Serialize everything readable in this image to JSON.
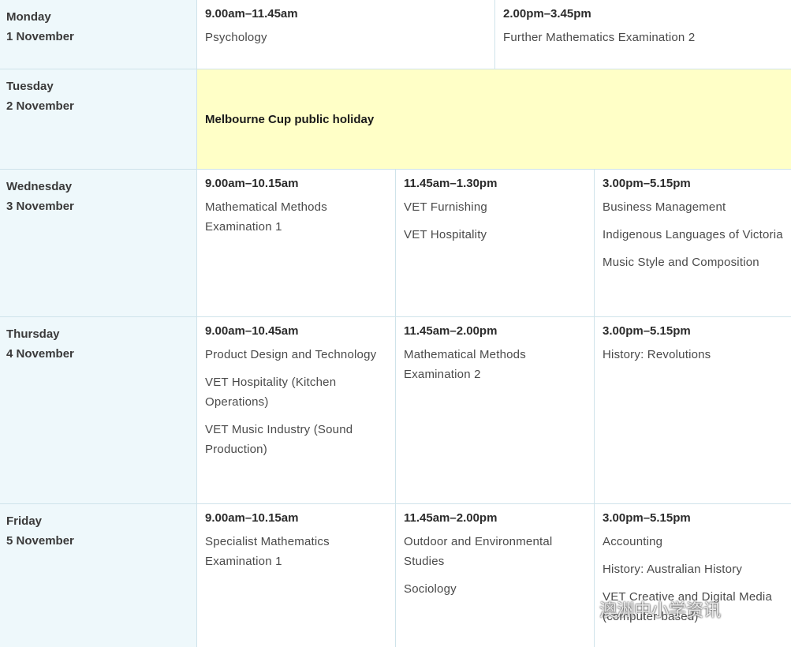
{
  "schedule": {
    "mon": {
      "day": "Monday",
      "date": "1 November",
      "slots": [
        {
          "time": "9.00am–11.45am",
          "subjects": [
            "Psychology"
          ]
        },
        {
          "time": "2.00pm–3.45pm",
          "subjects": [
            "Further Mathematics Examination 2"
          ]
        }
      ]
    },
    "tue": {
      "day": "Tuesday",
      "date": "2 November",
      "holiday": "Melbourne Cup public holiday",
      "holiday_color": "#ffffc7"
    },
    "wed": {
      "day": "Wednesday",
      "date": "3 November",
      "slots": [
        {
          "time": "9.00am–10.15am",
          "subjects": [
            "Mathematical Methods Examination 1"
          ]
        },
        {
          "time": "11.45am–1.30pm",
          "subjects": [
            "VET Furnishing",
            "VET Hospitality"
          ]
        },
        {
          "time": "3.00pm–5.15pm",
          "subjects": [
            "Business Management",
            "Indigenous Languages of Victoria",
            "Music Style and Composition"
          ]
        }
      ]
    },
    "thu": {
      "day": "Thursday",
      "date": "4 November",
      "slots": [
        {
          "time": "9.00am–10.45am",
          "subjects": [
            "Product Design and Technology",
            "VET Hospitality (Kitchen Operations)",
            "VET Music Industry (Sound Production)"
          ]
        },
        {
          "time": "11.45am–2.00pm",
          "subjects": [
            "Mathematical Methods Examination 2"
          ]
        },
        {
          "time": "3.00pm–5.15pm",
          "subjects": [
            "History: Revolutions"
          ]
        }
      ]
    },
    "fri": {
      "day": "Friday",
      "date": "5 November",
      "slots": [
        {
          "time": "9.00am–10.15am",
          "subjects": [
            "Specialist Mathematics Examination 1"
          ]
        },
        {
          "time": "11.45am–2.00pm",
          "subjects": [
            "Outdoor and Environmental Studies",
            "Sociology"
          ]
        },
        {
          "time": "3.00pm–5.15pm",
          "subjects": [
            "Accounting",
            "History: Australian History",
            "VET Creative and Digital Media (computer-based)"
          ]
        }
      ]
    }
  },
  "watermark": "澳洲中小学资讯",
  "colors": {
    "day_column": "#eef8fb",
    "border": "#cfe3ea",
    "holiday": "#ffffc7"
  }
}
